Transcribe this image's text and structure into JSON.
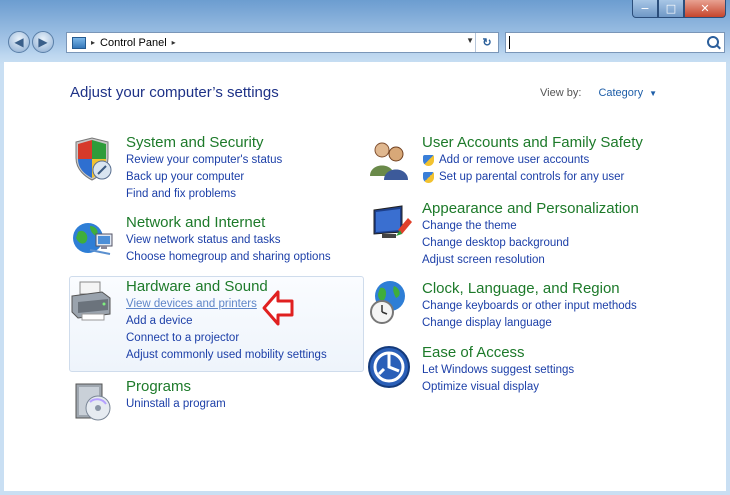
{
  "window": {
    "controls": {
      "minimize": "−",
      "maximize": "□",
      "close": "✕"
    }
  },
  "navbar": {
    "back": "◀",
    "forward": "▶",
    "address": {
      "crumb": "Control Panel",
      "sep1": "▸",
      "sep2": "▸"
    },
    "dropdown": "▼",
    "refresh": "↻",
    "search_value": ""
  },
  "page": {
    "heading": "Adjust your computer’s settings",
    "view_by_label": "View by:",
    "view_by_value": "Category"
  },
  "categories": {
    "system": {
      "title": "System and Security",
      "links": [
        "Review your computer's status",
        "Back up your computer",
        "Find and fix problems"
      ],
      "icon": "shield-icon"
    },
    "network": {
      "title": "Network and Internet",
      "links": [
        "View network status and tasks",
        "Choose homegroup and sharing options"
      ],
      "icon": "network-globe-icon"
    },
    "hardware": {
      "title": "Hardware and Sound",
      "links": [
        "View devices and printers",
        "Add a device",
        "Connect to a projector",
        "Adjust commonly used mobility settings"
      ],
      "icon": "printer-icon"
    },
    "programs": {
      "title": "Programs",
      "links": [
        "Uninstall a program"
      ],
      "icon": "programs-disc-icon"
    },
    "users": {
      "title": "User Accounts and Family Safety",
      "links": [
        "Add or remove user accounts",
        "Set up parental controls for any user"
      ],
      "icon": "users-icon"
    },
    "appearance": {
      "title": "Appearance and Personalization",
      "links": [
        "Change the theme",
        "Change desktop background",
        "Adjust screen resolution"
      ],
      "icon": "monitor-icon"
    },
    "clock": {
      "title": "Clock, Language, and Region",
      "links": [
        "Change keyboards or other input methods",
        "Change display language"
      ],
      "icon": "clock-globe-icon"
    },
    "ease": {
      "title": "Ease of Access",
      "links": [
        "Let Windows suggest settings",
        "Optimize visual display"
      ],
      "icon": "ease-of-access-icon"
    }
  },
  "colors": {
    "title_green": "#1d7a2a",
    "link_blue": "#1c3fa8",
    "heading_blue": "#1e3287",
    "arrow_red": "#e02020"
  }
}
